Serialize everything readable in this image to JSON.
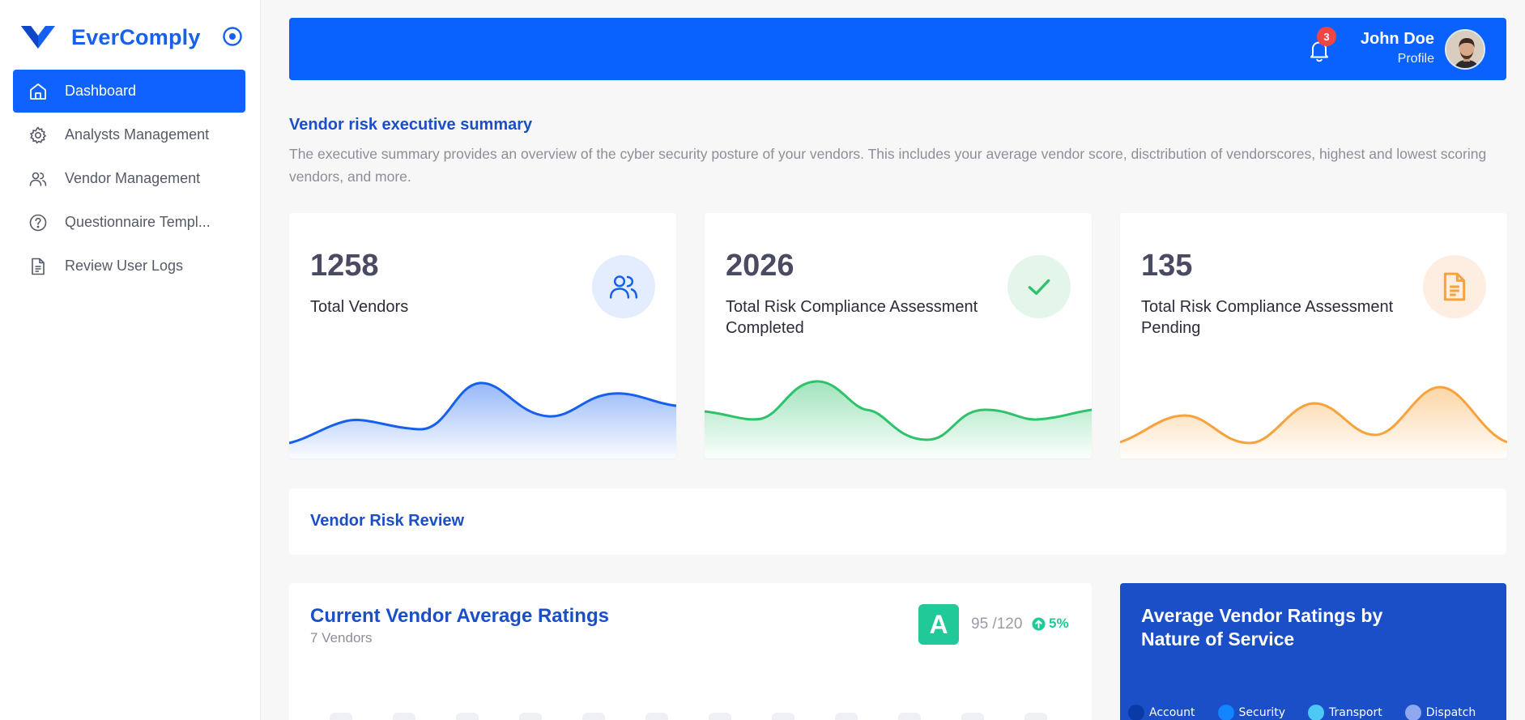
{
  "brand": {
    "name": "EverComply"
  },
  "nav": [
    {
      "label": "Dashboard",
      "icon": "home-icon",
      "active": true
    },
    {
      "label": "Analysts Management",
      "icon": "gear-icon",
      "active": false
    },
    {
      "label": "Vendor Management",
      "icon": "users-icon",
      "active": false
    },
    {
      "label": "Questionnaire Templ...",
      "icon": "help-circle-icon",
      "active": false
    },
    {
      "label": "Review User Logs",
      "icon": "document-icon",
      "active": false
    }
  ],
  "header": {
    "notification_count": "3",
    "user_name": "John Doe",
    "user_role": "Profile"
  },
  "summary": {
    "title": "Vendor risk executive summary",
    "description": "The executive summary provides an overview of the cyber security posture of your vendors. This includes your average vendor score, disctribution of vendorscores, highest and lowest scoring vendors, and more."
  },
  "stats": [
    {
      "value": "1258",
      "label": "Total Vendors",
      "icon": "users-icon",
      "color": "#1660f0"
    },
    {
      "value": "2026",
      "label": "Total Risk Compliance Assessment Completed",
      "icon": "check-icon",
      "color": "#2ec26a"
    },
    {
      "value": "135",
      "label": "Total Risk Compliance Assessment Pending",
      "icon": "document-icon",
      "color": "#f7a23b"
    }
  ],
  "review": {
    "title": "Vendor Risk Review"
  },
  "ratings": {
    "title": "Current Vendor Average Ratings",
    "subtitle": "7 Vendors",
    "grade": "A",
    "score": "95 /120",
    "change": "5%",
    "grade_color": "#20c997"
  },
  "service": {
    "title": "Average Vendor Ratings by Nature of Service",
    "legend": [
      {
        "label": "Account",
        "color": "#0a3aa8"
      },
      {
        "label": "Security",
        "color": "#1285ff"
      },
      {
        "label": "Transport",
        "color": "#4cc9f5"
      },
      {
        "label": "Dispatch",
        "color": "#8fa8f0"
      }
    ]
  }
}
